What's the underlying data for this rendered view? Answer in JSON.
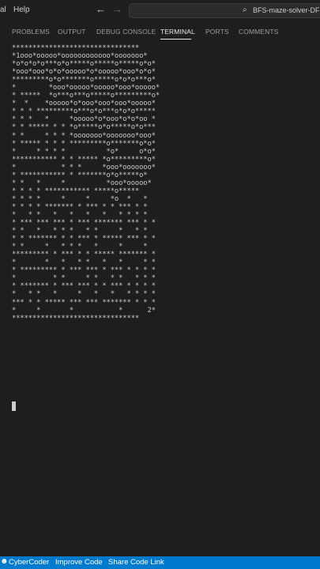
{
  "menu": [
    "al",
    "Help"
  ],
  "nav": {
    "back_icon": "←",
    "forward_icon": "→"
  },
  "search": {
    "text": "BFS-maze-solver-DFS",
    "icon": "⌕"
  },
  "panel": {
    "tabs": [
      "PROBLEMS",
      "OUTPUT",
      "DEBUG CONSOLE",
      "TERMINAL",
      "PORTS",
      "COMMENTS"
    ],
    "active_tab": "TERMINAL"
  },
  "terminal": {
    "lines": [
      "*******************************",
      "*1ooo*ooooo*oooooooooooo*ooooooo*",
      "*o*o*o*o***o*o*****o*****o*****o*o*",
      "*ooo*ooo*o*o*ooooo*o*ooooo*ooo*o*o*",
      "*********o*o*******o*****o*o*o***o*",
      "*        *ooo*ooooo*ooooo*ooo*ooooo*",
      "* *****  *o***o***o*****o*********o*",
      "*  *    *ooooo*o*ooo*ooo*ooo*ooooo*",
      "* * * *********o***o*o***o*o*o*****",
      "* * *   *     *ooooo*o*ooo*o*o*oo *",
      "* * ***** * * *o*****o*o*****o*o***",
      "* *     * * * *ooooooo*ooooooo*ooo*",
      "* ***** * * * *********o*******o*o*",
      "*     * * * *          *o*     o*o*",
      "*********** * * ***** *o*********o*",
      "*           * * *     *ooo*ooooooo*",
      "* *********** * *******o*o*****o*",
      "* *   *     *          *ooo*ooooo*",
      "* * * * *********** *****o*****",
      "* * * *     *     *     *o  *   *",
      "* * * * ******* * *** * * *** * *",
      "*   * *   *   *   *   *   * * * *",
      "* *** *** *** * *** ******* *** * *",
      "* *   *   * * *   * *     *   * *",
      "* * ******* * * *** * ***** *** * *",
      "* *     *   * * *   *     *     *",
      "********* * *** * * ***** ******* *",
      "*       *   *   * *   *   *     * *",
      "* ********* * *** *** * *** * * * *",
      "*         * *     * *   * *   * * *",
      "* ******* * *** *** * * *** * * * *",
      "*   * *   *     *   *   *   * * * *",
      "*** * * ***** *** *** ******* * * *",
      "*     *       *           *      2*",
      "*******************************"
    ]
  },
  "status": {
    "icon": "☻",
    "items": [
      "CyberCoder",
      "Improve Code",
      "Share Code Link"
    ]
  }
}
